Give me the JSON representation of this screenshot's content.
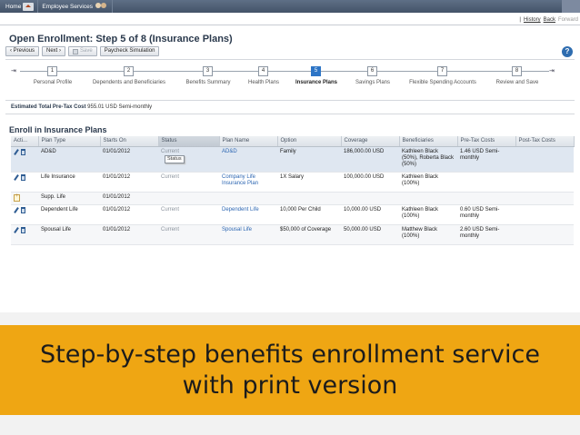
{
  "topnav": {
    "home": "Home",
    "employee_services": "Employee Services"
  },
  "toplinks": {
    "history": "History",
    "back": "Back",
    "forward": "Forward"
  },
  "page_title": "Open Enrollment: Step 5 of 8 (Insurance Plans)",
  "toolbar": {
    "previous": "‹ Previous",
    "next": "Next ›",
    "save": "Save",
    "paycheck": "Paycheck Simulation",
    "help": "?"
  },
  "roadmap": {
    "start_marker": "⇥",
    "end_marker": "⇥",
    "steps": [
      {
        "number": "1",
        "label": "Personal Profile"
      },
      {
        "number": "2",
        "label": "Dependents and Beneficiaries"
      },
      {
        "number": "3",
        "label": "Benefits Summary"
      },
      {
        "number": "4",
        "label": "Health Plans"
      },
      {
        "number": "5",
        "label": "Insurance Plans",
        "active": true
      },
      {
        "number": "6",
        "label": "Savings Plans"
      },
      {
        "number": "7",
        "label": "Flexible Spending Accounts"
      },
      {
        "number": "8",
        "label": "Review and Save"
      }
    ]
  },
  "cost": {
    "label": "Estimated Total Pre-Tax Cost",
    "value": "955.01 USD Semi-monthly"
  },
  "section_title": "Enroll in Insurance Plans",
  "table": {
    "headers": [
      "Acti...",
      "Plan Type",
      "Starts On",
      "Status",
      "Plan Name",
      "Option",
      "Coverage",
      "Beneficiaries",
      "Pre-Tax Costs",
      "Post-Tax Costs"
    ],
    "tooltip": "Status",
    "rows": [
      {
        "actions": "edit-delete",
        "plan_type": "AD&D",
        "starts_on": "01/01/2012",
        "status": "Current",
        "plan_name": "AD&D",
        "option": "Family",
        "coverage": "186,000.00 USD",
        "beneficiaries": "Kathleen Black (50%), Roberta Black (50%)",
        "pre_tax": "1.46 USD Semi-monthly",
        "post_tax": ""
      },
      {
        "actions": "edit-delete",
        "plan_type": "Life Insurance",
        "starts_on": "01/01/2012",
        "status": "Current",
        "plan_name": "Company Life Insurance Plan",
        "option": "1X Salary",
        "coverage": "100,000.00 USD",
        "beneficiaries": "Kathleen Black (100%)",
        "pre_tax": "",
        "post_tax": ""
      },
      {
        "actions": "add",
        "plan_type": "Supp. Life",
        "starts_on": "01/01/2012",
        "status": "",
        "plan_name": "",
        "option": "",
        "coverage": "",
        "beneficiaries": "",
        "pre_tax": "",
        "post_tax": ""
      },
      {
        "actions": "edit-delete",
        "plan_type": "Dependent Life",
        "starts_on": "01/01/2012",
        "status": "Current",
        "plan_name": "Dependent Life",
        "option": "10,000 Per Child",
        "coverage": "10,000.00 USD",
        "beneficiaries": "Kathleen Black (100%)",
        "pre_tax": "0.60 USD Semi-monthly",
        "post_tax": ""
      },
      {
        "actions": "edit-delete",
        "plan_type": "Spousal Life",
        "starts_on": "01/01/2012",
        "status": "Current",
        "plan_name": "Spousal Life",
        "option": "$50,000 of Coverage",
        "coverage": "50,000.00 USD",
        "beneficiaries": "Matthew Black (100%)",
        "pre_tax": "2.60 USD Semi-monthly",
        "post_tax": ""
      }
    ]
  },
  "banner": {
    "text": "Step-by-step benefits enrollment service with print version"
  },
  "colors": {
    "banner": "#efa613",
    "active_step": "#2d75c6",
    "link": "#2c66b2"
  }
}
